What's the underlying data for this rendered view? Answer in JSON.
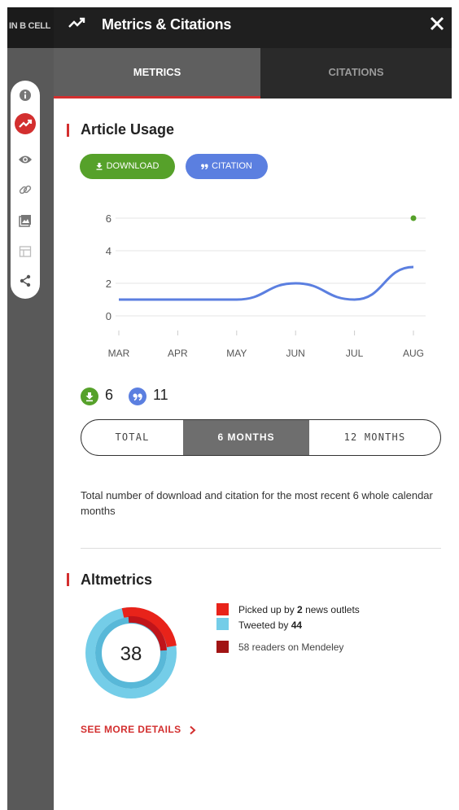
{
  "sidebar": {
    "top_label": "IN B CELL",
    "icons": [
      "info-icon",
      "trending-icon",
      "eye-icon",
      "link-icon",
      "image-icon",
      "table-icon",
      "share-icon"
    ]
  },
  "header": {
    "title": "Metrics & Citations",
    "close_label": "✕"
  },
  "tabs": [
    {
      "label": "METRICS",
      "active": true
    },
    {
      "label": "CITATIONS",
      "active": false
    }
  ],
  "usage": {
    "title": "Article Usage",
    "download_label": "DOWNLOAD",
    "citation_label": "CITATION",
    "download_count": "6",
    "citation_count": "11",
    "periods": [
      "TOTAL",
      "6 MONTHS",
      "12 MONTHS"
    ],
    "selected_period": "6 MONTHS",
    "description": "Total number of download and citation for the most recent 6 whole calendar months"
  },
  "chart_data": {
    "type": "line",
    "categories": [
      "MAR",
      "APR",
      "MAY",
      "JUN",
      "JUL",
      "AUG"
    ],
    "series": [
      {
        "values": [
          0,
          0,
          0,
          0,
          0,
          6
        ],
        "color": "#56a12a"
      },
      {
        "values": [
          1,
          1,
          1,
          2,
          1,
          3
        ],
        "color": "#5b7fe0"
      }
    ],
    "yticks": [
      6,
      4,
      2,
      0
    ],
    "ylim": [
      0,
      6
    ],
    "grid": true
  },
  "altmetrics": {
    "title": "Altmetrics",
    "score": "38",
    "news_prefix": "Picked up by ",
    "news_count": "2",
    "news_suffix": " news outlets",
    "tweet_prefix": "Tweeted by ",
    "tweet_count": "44",
    "mendeley_text": "58 readers on Mendeley",
    "colors": {
      "news": "#e8231a",
      "tweet": "#74cde8",
      "mendeley": "#a11414"
    },
    "see_more_label": "SEE MORE DETAILS"
  },
  "colors": {
    "accent": "#d32f2f",
    "download": "#56a12a",
    "citation": "#5b7fe0"
  }
}
